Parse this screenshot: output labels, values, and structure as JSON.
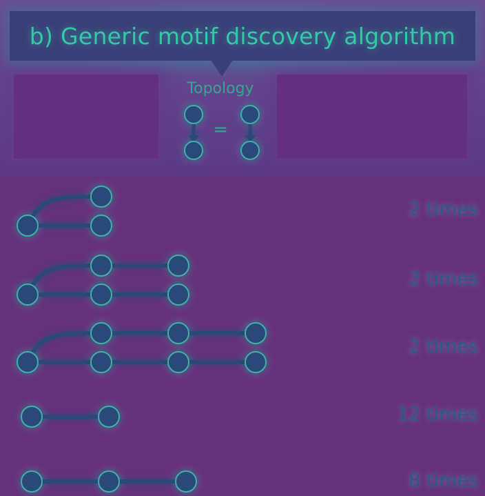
{
  "title": "b) Generic motif discovery algorithm",
  "topology": {
    "label": "Topology",
    "equals_sign": "="
  },
  "motifs": [
    {
      "count_label": "2 times",
      "kind": "branching",
      "branch_length": 2
    },
    {
      "count_label": "2 times",
      "kind": "branching",
      "branch_length": 3
    },
    {
      "count_label": "2 times",
      "kind": "branching",
      "branch_length": 4
    },
    {
      "count_label": "12 times",
      "kind": "chain",
      "node_count": 2
    },
    {
      "count_label": "8 times",
      "kind": "chain",
      "node_count": 3
    }
  ],
  "colors": {
    "background": "#5f3f87",
    "banner": "#3a3f78",
    "title_text": "#33c9a6",
    "node_fill": "#2a4a78",
    "node_glow": "#3fb0a8",
    "count_text": "#2c5a80"
  }
}
